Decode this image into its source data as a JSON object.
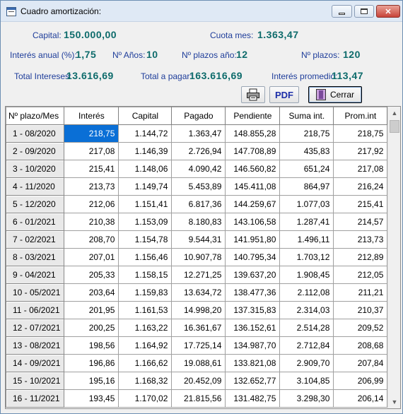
{
  "window": {
    "title": "Cuadro amortización:"
  },
  "summary": {
    "capital_label": "Capital:",
    "capital_value": "150.000,00",
    "cuota_label": "Cuota mes:",
    "cuota_value": "1.363,47",
    "interes_anual_label": "Interés anual (%):",
    "interes_anual_value": "1,75",
    "anios_label": "Nº Años:",
    "anios_value": "10",
    "plazos_anio_label": "Nº plazos año:",
    "plazos_anio_value": "12",
    "plazos_label": "Nº plazos:",
    "plazos_value": "120",
    "total_intereses_label": "Total Intereses:",
    "total_intereses_value": "13.616,69",
    "total_pagar_label": "Total a pagar:",
    "total_pagar_value": "163.616,69",
    "interes_promedio_label": "Interés promedio:",
    "interes_promedio_value": "113,47"
  },
  "toolbar": {
    "print_icon": "printer-icon",
    "pdf_label": "PDF",
    "cerrar_label": "Cerrar",
    "cerrar_icon": "exit-door-icon"
  },
  "table": {
    "columns": [
      "Nº plazo/Mes",
      "Interés",
      "Capital",
      "Pagado",
      "Pendiente",
      "Suma int.",
      "Prom.int"
    ],
    "selected_cell": {
      "row": 0,
      "col": 1
    },
    "rows": [
      [
        "1 - 08/2020",
        "218,75",
        "1.144,72",
        "1.363,47",
        "148.855,28",
        "218,75",
        "218,75"
      ],
      [
        "2 - 09/2020",
        "217,08",
        "1.146,39",
        "2.726,94",
        "147.708,89",
        "435,83",
        "217,92"
      ],
      [
        "3 - 10/2020",
        "215,41",
        "1.148,06",
        "4.090,42",
        "146.560,82",
        "651,24",
        "217,08"
      ],
      [
        "4 - 11/2020",
        "213,73",
        "1.149,74",
        "5.453,89",
        "145.411,08",
        "864,97",
        "216,24"
      ],
      [
        "5 - 12/2020",
        "212,06",
        "1.151,41",
        "6.817,36",
        "144.259,67",
        "1.077,03",
        "215,41"
      ],
      [
        "6 - 01/2021",
        "210,38",
        "1.153,09",
        "8.180,83",
        "143.106,58",
        "1.287,41",
        "214,57"
      ],
      [
        "7 - 02/2021",
        "208,70",
        "1.154,78",
        "9.544,31",
        "141.951,80",
        "1.496,11",
        "213,73"
      ],
      [
        "8 - 03/2021",
        "207,01",
        "1.156,46",
        "10.907,78",
        "140.795,34",
        "1.703,12",
        "212,89"
      ],
      [
        "9 - 04/2021",
        "205,33",
        "1.158,15",
        "12.271,25",
        "139.637,20",
        "1.908,45",
        "212,05"
      ],
      [
        "10 - 05/2021",
        "203,64",
        "1.159,83",
        "13.634,72",
        "138.477,36",
        "2.112,08",
        "211,21"
      ],
      [
        "11 - 06/2021",
        "201,95",
        "1.161,53",
        "14.998,20",
        "137.315,83",
        "2.314,03",
        "210,37"
      ],
      [
        "12 - 07/2021",
        "200,25",
        "1.163,22",
        "16.361,67",
        "136.152,61",
        "2.514,28",
        "209,52"
      ],
      [
        "13 - 08/2021",
        "198,56",
        "1.164,92",
        "17.725,14",
        "134.987,70",
        "2.712,84",
        "208,68"
      ],
      [
        "14 - 09/2021",
        "196,86",
        "1.166,62",
        "19.088,61",
        "133.821,08",
        "2.909,70",
        "207,84"
      ],
      [
        "15 - 10/2021",
        "195,16",
        "1.168,32",
        "20.452,09",
        "132.652,77",
        "3.104,85",
        "206,99"
      ],
      [
        "16 - 11/2021",
        "193,45",
        "1.170,02",
        "21.815,56",
        "131.482,75",
        "3.298,30",
        "206,14"
      ]
    ]
  },
  "colors": {
    "label": "#1e3d9a",
    "value": "#0d6b6b",
    "selection": "#0a6fd6"
  }
}
